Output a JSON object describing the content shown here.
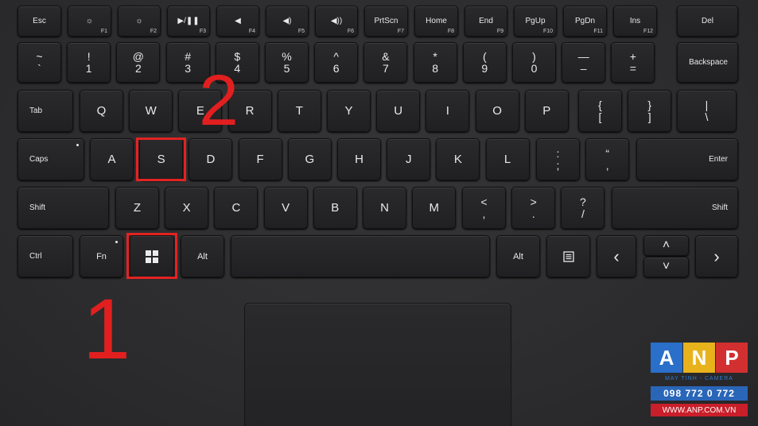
{
  "fkeys": [
    "Esc",
    "☼",
    "☼",
    "▶/❚❚",
    "◀",
    "◀)",
    "◀))",
    "PrtScn",
    "Home",
    "End",
    "PgUp",
    "PgDn",
    "Ins",
    "Del"
  ],
  "fkey_sub": [
    "",
    "F1",
    "F2",
    "F3",
    "F4",
    "F5",
    "F6",
    "F7",
    "F8",
    "F9",
    "F10",
    "F11",
    "F12",
    ""
  ],
  "num_row": [
    {
      "t": "~",
      "b": "`"
    },
    {
      "t": "!",
      "b": "1"
    },
    {
      "t": "@",
      "b": "2"
    },
    {
      "t": "#",
      "b": "3"
    },
    {
      "t": "$",
      "b": "4"
    },
    {
      "t": "%",
      "b": "5"
    },
    {
      "t": "^",
      "b": "6"
    },
    {
      "t": "&",
      "b": "7"
    },
    {
      "t": "*",
      "b": "8"
    },
    {
      "t": "(",
      "b": "9"
    },
    {
      "t": ")",
      "b": "0"
    },
    {
      "t": "—",
      "b": "–"
    },
    {
      "t": "+",
      "b": "="
    }
  ],
  "backspace": "Backspace",
  "tab": "Tab",
  "qrow": [
    "Q",
    "W",
    "E",
    "R",
    "T",
    "Y",
    "U",
    "I",
    "O",
    "P"
  ],
  "qrow_sym": [
    {
      "t": "{",
      "b": "["
    },
    {
      "t": "}",
      "b": "]"
    },
    {
      "t": "|",
      "b": "\\"
    }
  ],
  "caps": "Caps",
  "arow": [
    "A",
    "S",
    "D",
    "F",
    "G",
    "H",
    "J",
    "K",
    "L"
  ],
  "arow_sym": [
    {
      "t": ":",
      "b": ";"
    },
    {
      "t": "“",
      "b": "‚"
    }
  ],
  "enter": "Enter",
  "shift_l": "Shift",
  "zrow": [
    "Z",
    "X",
    "C",
    "V",
    "B",
    "N",
    "M"
  ],
  "zrow_sym": [
    {
      "t": "<",
      "b": ","
    },
    {
      "t": ">",
      "b": "."
    },
    {
      "t": "?",
      "b": "/"
    }
  ],
  "shift_r": "Shift",
  "ctrl": "Ctrl",
  "fn": "Fn",
  "alt_l": "Alt",
  "alt_r": "Alt",
  "arrows": {
    "left": "‹",
    "up": "˄",
    "down": "˅",
    "right": "›"
  },
  "annot_1": "1",
  "annot_2": "2",
  "highlight_color": "#e32222",
  "logo": {
    "a": "A",
    "n": "N",
    "p": "P",
    "a_color": "#2a6fc9",
    "n_color": "#e8b21c",
    "p_color": "#d23030",
    "sub": "MAY TINH - CAMERA",
    "phone": "098 772 0 772",
    "web": "WWW.ANP.COM.VN"
  }
}
